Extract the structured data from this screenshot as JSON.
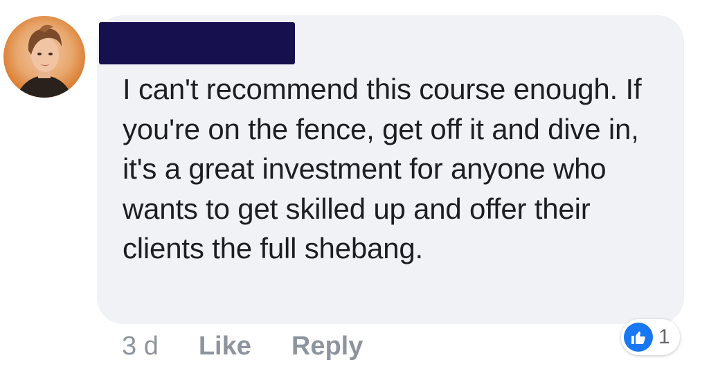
{
  "comment": {
    "text": "I can't recommend this course enough. If you're on the fence, get off it and dive in, it's a great investment for anyone who wants to get skilled up and offer their clients the full shebang."
  },
  "actions": {
    "time": "3 d",
    "like_label": "Like",
    "reply_label": "Reply"
  },
  "reactions": {
    "icon": "thumbs-up-icon",
    "count": "1"
  },
  "colors": {
    "bubble": "#f0f2f5",
    "text": "#1c1e21",
    "meta": "#8d949e",
    "like_blue": "#1877f2",
    "redaction": "#16104f"
  }
}
